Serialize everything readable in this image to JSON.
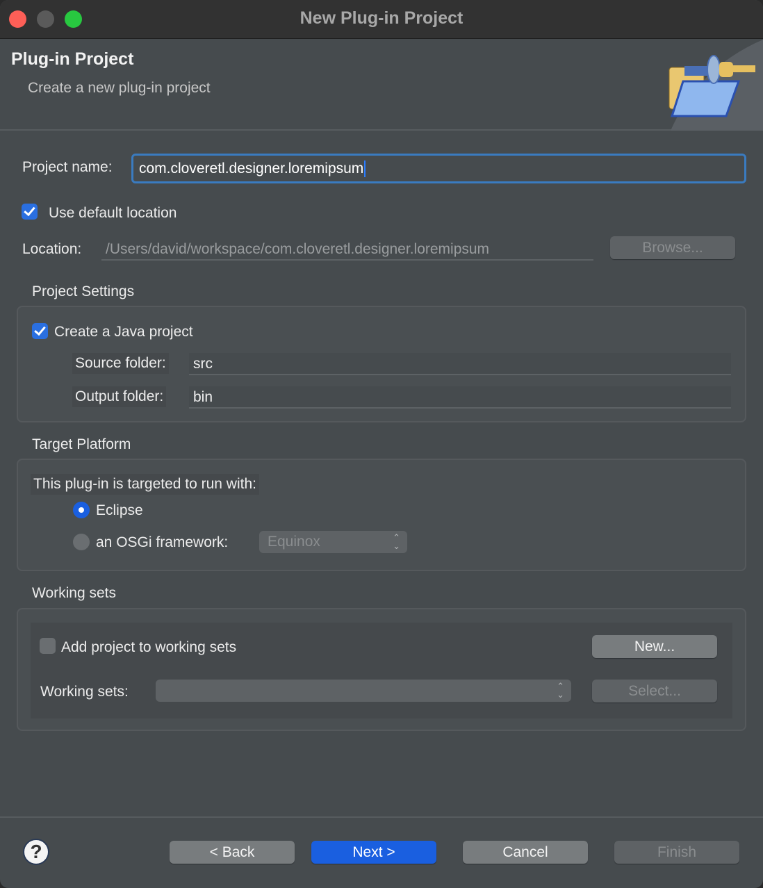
{
  "window": {
    "title": "New Plug-in Project"
  },
  "header": {
    "title": "Plug-in Project",
    "subtitle": "Create a new plug-in project",
    "icon": "plugin-folder-icon"
  },
  "project_name": {
    "label": "Project name:",
    "value": "com.cloveretl.designer.loremipsum"
  },
  "default_location": {
    "label": "Use default location",
    "checked": true
  },
  "location": {
    "label": "Location:",
    "value": "/Users/david/workspace/com.cloveretl.designer.loremipsum",
    "browse_label": "Browse..."
  },
  "project_settings": {
    "title": "Project Settings",
    "java_label": "Create a Java project",
    "java_checked": true,
    "source_label": "Source folder:",
    "source_value": "src",
    "output_label": "Output folder:",
    "output_value": "bin"
  },
  "target_platform": {
    "title": "Target Platform",
    "prompt": "This plug-in is targeted to run with:",
    "eclipse_label": "Eclipse",
    "osgi_label": "an OSGi framework:",
    "selected": "Eclipse",
    "osgi_value": "Equinox"
  },
  "working_sets": {
    "title": "Working sets",
    "add_label": "Add project to working sets",
    "add_checked": false,
    "new_label": "New...",
    "sets_label": "Working sets:",
    "sets_value": "",
    "select_label": "Select..."
  },
  "footer": {
    "help_icon": "help-icon",
    "back": "< Back",
    "next": "Next >",
    "cancel": "Cancel",
    "finish": "Finish"
  },
  "colors": {
    "accent": "#1a5fe0",
    "focus_ring": "#3a7bc0",
    "close": "#fe5f57",
    "minimize": "#5a5a5a",
    "maximize": "#28c840"
  }
}
